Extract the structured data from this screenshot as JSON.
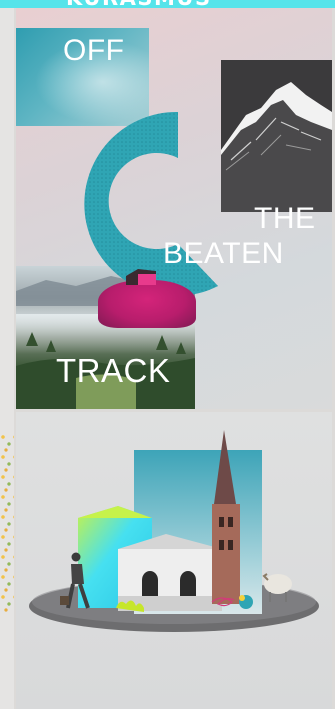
{
  "header": {
    "banner_text": "KURASMUS"
  },
  "poster": {
    "word_1": "OFF",
    "word_2": "THE",
    "word_3": "BEATEN",
    "word_4": "TRACK"
  },
  "colors": {
    "banner": "#56e4ea",
    "crescent": "#2fa5b4",
    "flowers": "#d4247a",
    "barn": "#e83a8c",
    "mountain": "#3b3a3c",
    "gradient_cyan": "#46e0f0",
    "gradient_lime": "#c6f24a"
  }
}
